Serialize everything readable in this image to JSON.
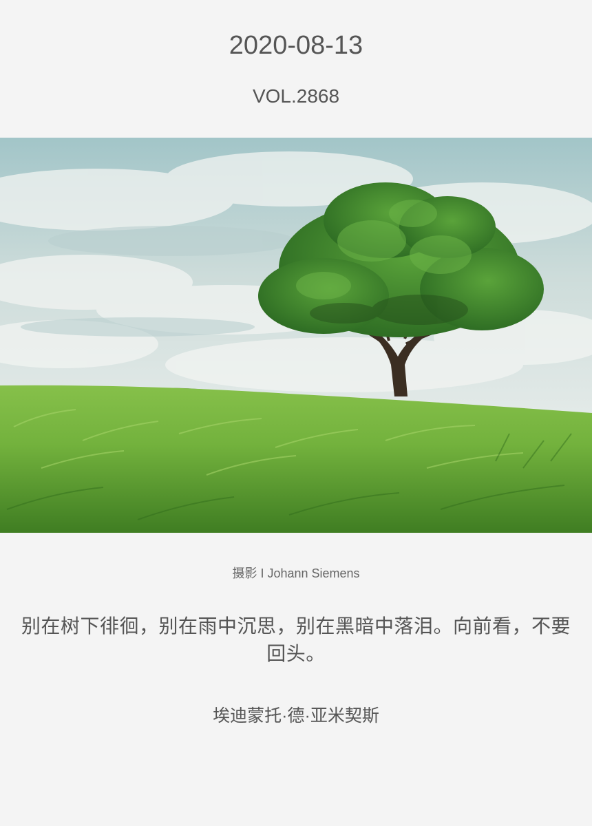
{
  "header": {
    "date": "2020-08-13",
    "volume": "VOL.2868"
  },
  "photo": {
    "subject": "lone-tree-grass-field-image",
    "colors": {
      "sky_top": "#9fc3c6",
      "sky_bottom": "#e8eeec",
      "grass_dark": "#3f7d22",
      "grass_light": "#8cc84b",
      "canopy": "#3e8a2c",
      "trunk": "#3b2e22"
    }
  },
  "caption": {
    "credit": "摄影 I Johann Siemens"
  },
  "quote": {
    "text": "别在树下徘徊，别在雨中沉思，别在黑暗中落泪。向前看，不要回头。",
    "author": "埃迪蒙托·德·亚米契斯"
  }
}
